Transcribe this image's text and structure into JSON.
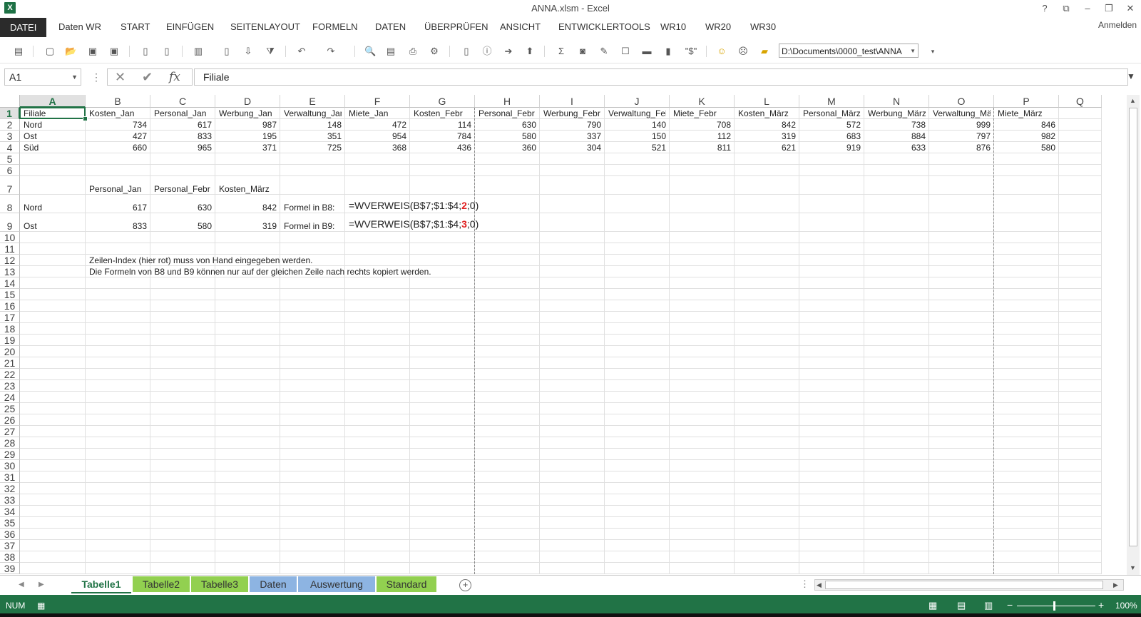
{
  "window": {
    "title": "ANNA.xlsm - Excel",
    "controls": [
      "?",
      "⧉",
      "–",
      "❐",
      "✕"
    ]
  },
  "ribbon": {
    "tabs": [
      "DATEI",
      "Daten WR",
      "START",
      "EINFÜGEN",
      "SEITENLAYOUT",
      "FORMELN",
      "DATEN",
      "ÜBERPRÜFEN",
      "ANSICHT",
      "ENTWICKLERTOOLS",
      "WR10",
      "WR20",
      "WR30"
    ],
    "active_tab": "DATEI",
    "account": "Anmelden"
  },
  "toolbar": {
    "path_value": "D:\\Documents\\0000_test\\ANNA",
    "icons": [
      "quick-print-icon",
      "new-icon",
      "open-icon",
      "save-as-icon",
      "save-icon",
      "copy-file-icon",
      "paste-special-icon",
      "paste-icon",
      "clipboard-icon",
      "sort-icon",
      "filter-icon",
      "undo-icon",
      "redo-icon",
      "search-icon",
      "print-preview-icon",
      "print-icon",
      "options-icon",
      "page-icon",
      "info-icon",
      "arrow-right-icon",
      "arrow-up-icon",
      "sum-icon",
      "camera-icon",
      "format-painter-icon",
      "border-icon",
      "rows-icon",
      "chart-icon",
      "currency-icon",
      "smiley-icon",
      "sad-icon",
      "folder-icon"
    ],
    "icon_glyphs": [
      "▤",
      "▢",
      "📂",
      "▣",
      "▣",
      "▯",
      "▯",
      "▥",
      "▯",
      "⇩",
      "⧩",
      "↶",
      "↷",
      "🔍",
      "▤",
      "⎙",
      "⚙",
      "▯",
      "ⓘ",
      "➔",
      "⬆",
      "Σ",
      "◙",
      "✎",
      "☐",
      "▬",
      "▮",
      "\"$\"",
      "☺",
      "☹",
      "▰"
    ]
  },
  "formula_bar": {
    "name_box": "A1",
    "fx_symbol": "fx",
    "cancel_symbol": "✕",
    "enter_symbol": "✔",
    "formula": "Filiale"
  },
  "grid": {
    "columns": [
      "A",
      "B",
      "C",
      "D",
      "E",
      "F",
      "G",
      "H",
      "I",
      "J",
      "K",
      "L",
      "M",
      "N",
      "O",
      "P",
      "Q"
    ],
    "rows": [
      "1",
      "2",
      "3",
      "4",
      "5",
      "6",
      "7",
      "8",
      "9",
      "10",
      "11",
      "12",
      "13",
      "14",
      "15",
      "16",
      "17",
      "18",
      "19",
      "20",
      "21",
      "22",
      "23",
      "24",
      "25",
      "26",
      "27",
      "28",
      "29",
      "30",
      "31",
      "32",
      "33",
      "34",
      "35",
      "36",
      "37",
      "38",
      "39"
    ],
    "header_row": [
      "Filiale",
      "Kosten_Jan",
      "Personal_Jan",
      "Werbung_Jan",
      "Verwaltung_Jan",
      "Miete_Jan",
      "Kosten_Febr",
      "Personal_Febr",
      "Werbung_Febr",
      "Verwaltung_Febr",
      "Miete_Febr",
      "Kosten_März",
      "Personal_März",
      "Werbung_März",
      "Verwaltung_März",
      "Miete_März"
    ],
    "data_rows": [
      {
        "name": "Nord",
        "values": [
          "734",
          "617",
          "987",
          "148",
          "472",
          "114",
          "630",
          "790",
          "140",
          "708",
          "842",
          "572",
          "738",
          "999",
          "846"
        ]
      },
      {
        "name": "Ost",
        "values": [
          "427",
          "833",
          "195",
          "351",
          "954",
          "784",
          "580",
          "337",
          "150",
          "112",
          "319",
          "683",
          "884",
          "797",
          "982"
        ]
      },
      {
        "name": "Süd",
        "values": [
          "660",
          "965",
          "371",
          "725",
          "368",
          "436",
          "360",
          "304",
          "521",
          "811",
          "621",
          "919",
          "633",
          "876",
          "580"
        ]
      }
    ],
    "lookup_headers": [
      "Personal_Jan",
      "Personal_Febr",
      "Kosten_März"
    ],
    "lookup_rows": [
      {
        "name": "Nord",
        "values": [
          "617",
          "630",
          "842"
        ],
        "label": "Formel in B8:",
        "formula_pre": "=WVERWEIS(B$7;$1:$4;",
        "formula_index": "2",
        "formula_post": ";0)"
      },
      {
        "name": "Ost",
        "values": [
          "833",
          "580",
          "319"
        ],
        "label": "Formel in B9:",
        "formula_pre": "=WVERWEIS(B$7;$1:$4;",
        "formula_index": "3",
        "formula_post": ";0)"
      }
    ],
    "notes": [
      "Zeilen-Index (hier rot) muss von Hand eingegeben werden.",
      "Die Formeln von B8 und B9 können nur auf der gleichen Zeile nach rechts kopiert werden."
    ]
  },
  "sheets": {
    "tabs": [
      {
        "label": "Tabelle1",
        "color": "#ffffff",
        "active": true
      },
      {
        "label": "Tabelle2",
        "color": "#92d050",
        "active": false
      },
      {
        "label": "Tabelle3",
        "color": "#92d050",
        "active": false
      },
      {
        "label": "Daten",
        "color": "#8db4e2",
        "active": false
      },
      {
        "label": "Auswertung",
        "color": "#8db4e2",
        "active": false
      },
      {
        "label": "Standard",
        "color": "#92d050",
        "active": false
      }
    ],
    "add_symbol": "+"
  },
  "status": {
    "mode": "NUM",
    "zoom": "100%"
  },
  "colors": {
    "accent": "#217346",
    "formula_index": "#e02020"
  }
}
